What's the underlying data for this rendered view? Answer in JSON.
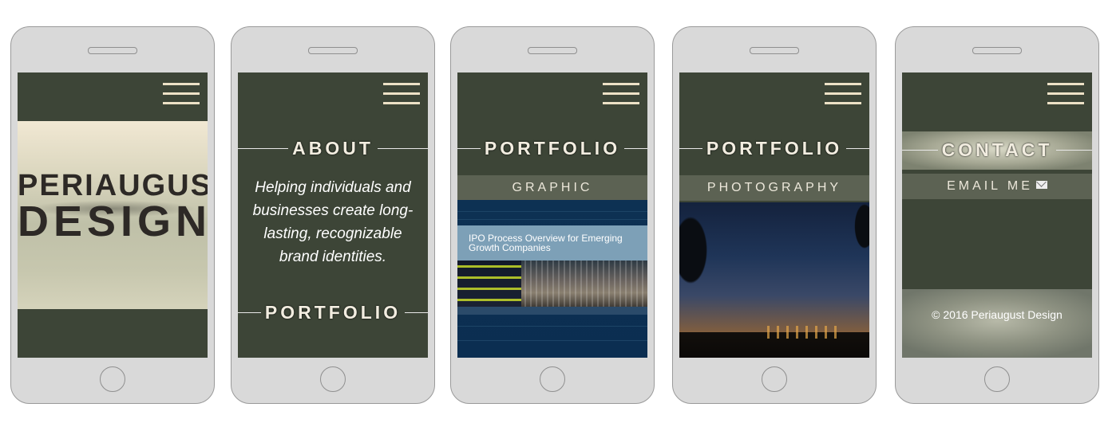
{
  "screens": [
    {
      "hero_line1": "PERIAUGUST",
      "hero_line2": "DESIGN"
    },
    {
      "heading": "ABOUT",
      "body": "Helping individuals and businesses create long-lasting, recognizable brand identities.",
      "heading2": "PORTFOLIO"
    },
    {
      "heading": "PORTFOLIO",
      "category": "GRAPHIC",
      "image_caption": "IPO Process Overview for Emerging Growth Companies"
    },
    {
      "heading": "PORTFOLIO",
      "category": "PHOTOGRAPHY"
    },
    {
      "heading": "CONTACT",
      "email_label": "EMAIL ME",
      "footer": "© 2016 Periaugust Design"
    }
  ],
  "icons": {
    "menu": "hamburger-menu-icon",
    "mail": "envelope-icon"
  },
  "colors": {
    "screen_bg": "#3d4537",
    "accent_text": "#f2ede0",
    "band_bg": "#5c6253",
    "phone_body": "#d9d9d9"
  }
}
